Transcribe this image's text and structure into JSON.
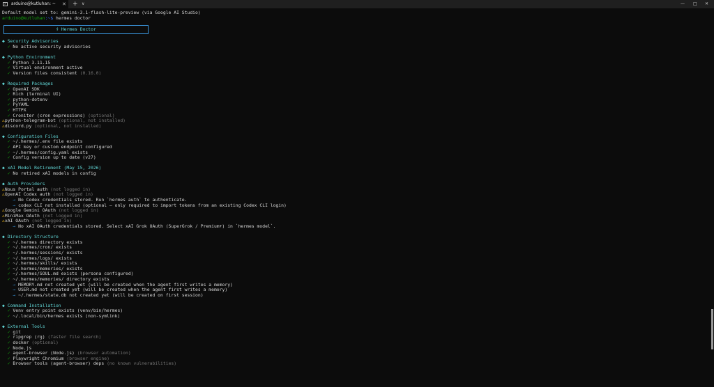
{
  "window": {
    "tab_title": "arduino@kutluhan: ~",
    "tab_icon": "terminal-icon",
    "new_tab": "+",
    "dropdown": "∨",
    "minimize": "—",
    "maximize": "□",
    "close": "✕"
  },
  "terminal": {
    "status_line": "Default model set to: gemini-3.1-flash-lite-preview (via Google AI Studio)",
    "prompt_user": "arduino@kutluhan",
    "prompt_path": ":~$",
    "command": " hermes doctor",
    "banner": "⚕ Hermes Doctor",
    "sections": [
      {
        "title": "Security Advisories",
        "items": [
          {
            "status": "ok",
            "text": "No active security advisories",
            "note": ""
          }
        ]
      },
      {
        "title": "Python Environment",
        "items": [
          {
            "status": "ok",
            "text": "Python 3.11.15",
            "note": ""
          },
          {
            "status": "ok",
            "text": "Virtual environment active",
            "note": ""
          },
          {
            "status": "ok",
            "text": "Version files consistent",
            "note": "(0.16.0)"
          }
        ]
      },
      {
        "title": "Required Packages",
        "items": [
          {
            "status": "ok",
            "text": "OpenAI SDK",
            "note": ""
          },
          {
            "status": "ok",
            "text": "Rich (terminal UI)",
            "note": ""
          },
          {
            "status": "ok",
            "text": "python-dotenv",
            "note": ""
          },
          {
            "status": "ok",
            "text": "PyYAML",
            "note": ""
          },
          {
            "status": "ok",
            "text": "HTTPX",
            "note": ""
          },
          {
            "status": "ok",
            "text": "Croniter (cron expressions)",
            "note": "(optional)"
          },
          {
            "status": "warn",
            "text": "python-telegram-bot",
            "note": "(optional, not installed)"
          },
          {
            "status": "warn",
            "text": "discord.py",
            "note": "(optional, not installed)"
          }
        ]
      },
      {
        "title": "Configuration Files",
        "items": [
          {
            "status": "ok",
            "text": "~/.hermes/.env file exists",
            "note": ""
          },
          {
            "status": "ok",
            "text": "API key or custom endpoint configured",
            "note": ""
          },
          {
            "status": "ok",
            "text": "~/.hermes/config.yaml exists",
            "note": ""
          },
          {
            "status": "ok",
            "text": "Config version up to date (v27)",
            "note": ""
          }
        ]
      },
      {
        "title": "xAI Model Retirement (May 15, 2026)",
        "items": [
          {
            "status": "ok",
            "text": "No retired xAI models in config",
            "note": ""
          }
        ]
      },
      {
        "title": "Auth Providers",
        "items": [
          {
            "status": "warn",
            "text": "Nous Portal auth",
            "note": "(not logged in)"
          },
          {
            "status": "warn",
            "text": "OpenAI Codex auth",
            "note": "(not logged in)"
          },
          {
            "status": "info",
            "text": "No Codex credentials stored. Run `hermes auth` to authenticate.",
            "note": ""
          },
          {
            "status": "info",
            "text": "codex CLI not installed (optional — only required to import tokens from an existing Codex CLI login)",
            "note": ""
          },
          {
            "status": "warn",
            "text": "Google Gemini OAuth",
            "note": "(not logged in)"
          },
          {
            "status": "warn",
            "text": "MiniMax OAuth",
            "note": "(not logged in)"
          },
          {
            "status": "warn",
            "text": "xAI OAuth",
            "note": "(not logged in)"
          },
          {
            "status": "info",
            "text": "No xAI OAuth credentials stored. Select xAI Grok OAuth (SuperGrok / Premium+) in `hermes model`.",
            "note": ""
          }
        ]
      },
      {
        "title": "Directory Structure",
        "items": [
          {
            "status": "ok",
            "text": "~/.hermes directory exists",
            "note": ""
          },
          {
            "status": "ok",
            "text": "~/.hermes/cron/ exists",
            "note": ""
          },
          {
            "status": "ok",
            "text": "~/.hermes/sessions/ exists",
            "note": ""
          },
          {
            "status": "ok",
            "text": "~/.hermes/logs/ exists",
            "note": ""
          },
          {
            "status": "ok",
            "text": "~/.hermes/skills/ exists",
            "note": ""
          },
          {
            "status": "ok",
            "text": "~/.hermes/memories/ exists",
            "note": ""
          },
          {
            "status": "ok",
            "text": "~/.hermes/SOUL.md exists (persona configured)",
            "note": ""
          },
          {
            "status": "ok",
            "text": "~/.hermes/memories/ directory exists",
            "note": ""
          },
          {
            "status": "info",
            "text": "MEMORY.md not created yet (will be created when the agent first writes a memory)",
            "note": ""
          },
          {
            "status": "info",
            "text": "USER.md not created yet (will be created when the agent first writes a memory)",
            "note": ""
          },
          {
            "status": "info",
            "text": "~/.hermes/state.db not created yet (will be created on first session)",
            "note": ""
          }
        ]
      },
      {
        "title": "Command Installation",
        "items": [
          {
            "status": "ok",
            "text": "Venv entry point exists (venv/bin/hermes)",
            "note": ""
          },
          {
            "status": "ok",
            "text": "~/.local/bin/hermes exists (non-symlink)",
            "note": ""
          }
        ]
      },
      {
        "title": "External Tools",
        "items": [
          {
            "status": "ok",
            "text": "git",
            "note": ""
          },
          {
            "status": "ok",
            "text": "ripgrep (rg)",
            "note": "(faster file search)"
          },
          {
            "status": "ok",
            "text": "docker",
            "note": "(optional)"
          },
          {
            "status": "ok",
            "text": "Node.js",
            "note": ""
          },
          {
            "status": "ok",
            "text": "agent-browser (Node.js)",
            "note": "(browser automation)"
          },
          {
            "status": "ok",
            "text": "Playwright Chromium",
            "note": "(browser engine)"
          },
          {
            "status": "ok",
            "text": "Browser tools (agent-browser) deps",
            "note": "(no known vulnerabilities)"
          }
        ]
      }
    ]
  },
  "colors": {
    "background": "#0c0c0c",
    "section": "#61d6d6",
    "ok": "#13a10e",
    "warn": "#f9c11a",
    "dim": "#767676",
    "arrow": "#3a96dd"
  }
}
